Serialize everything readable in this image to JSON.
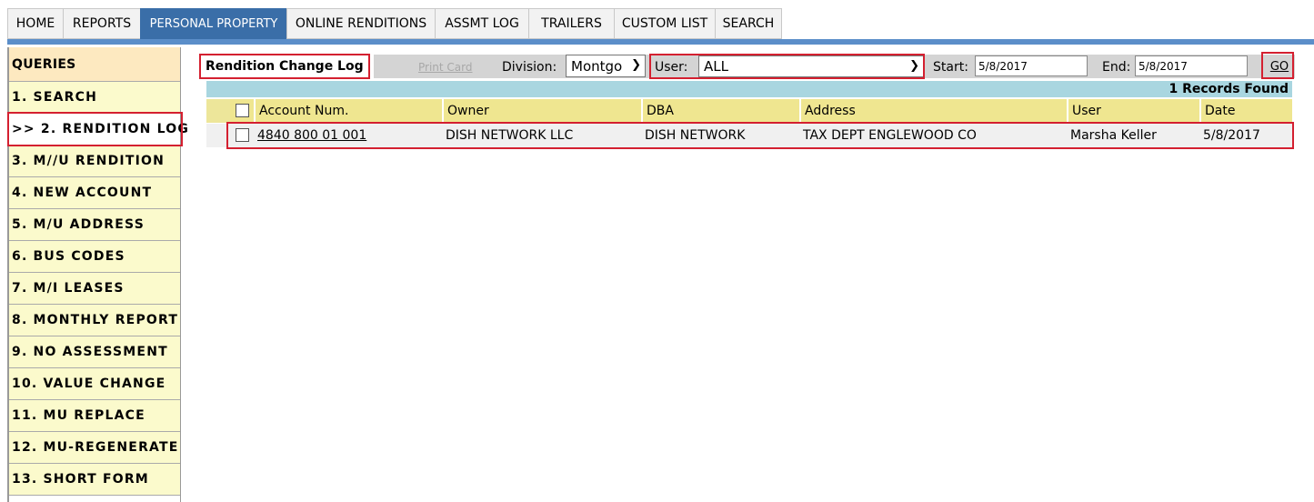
{
  "nav": {
    "tabs": [
      {
        "label": "HOME"
      },
      {
        "label": "REPORTS"
      },
      {
        "label": "PERSONAL PROPERTY"
      },
      {
        "label": "ONLINE RENDITIONS"
      },
      {
        "label": "ASSMT LOG"
      },
      {
        "label": "TRAILERS"
      },
      {
        "label": "CUSTOM LIST"
      },
      {
        "label": "SEARCH"
      }
    ],
    "active_tab": "PERSONAL PROPERTY",
    "accent_color": "#3a6ea8"
  },
  "sidebar": {
    "header": "QUERIES",
    "items": [
      {
        "label": "1. SEARCH"
      },
      {
        "label": ">> 2. RENDITION LOG"
      },
      {
        "label": "3. M//U RENDITION"
      },
      {
        "label": "4. NEW ACCOUNT"
      },
      {
        "label": "5. M/U ADDRESS"
      },
      {
        "label": "6. BUS CODES"
      },
      {
        "label": "7. M/I LEASES"
      },
      {
        "label": "8. MONTHLY REPORT"
      },
      {
        "label": "9. NO ASSESSMENT"
      },
      {
        "label": "10. VALUE CHANGE"
      },
      {
        "label": "11. MU REPLACE"
      },
      {
        "label": "12. MU-REGENERATE"
      },
      {
        "label": "13. SHORT FORM"
      }
    ]
  },
  "toolbar": {
    "title": "Rendition Change Log",
    "print_card": "Print Card",
    "division_label": "Division:",
    "division_value": "Montgo",
    "user_label": "User:",
    "user_value": "ALL",
    "start_label": "Start:",
    "start_value": "5/8/2017",
    "end_label": "End:",
    "end_value": "5/8/2017",
    "go_label": "GO"
  },
  "results": {
    "records_found": "1 Records Found",
    "columns": [
      "Account Num.",
      "Owner",
      "DBA",
      "Address",
      "User",
      "Date"
    ],
    "rows": [
      {
        "account": "4840 800 01 001",
        "owner": "DISH NETWORK LLC",
        "dba": "DISH NETWORK",
        "address": "TAX DEPT ENGLEWOOD CO",
        "user": "Marsha Keller",
        "date": "5/8/2017"
      }
    ]
  },
  "colors": {
    "highlight": "#d42030",
    "header_row": "#efe690",
    "records_bar": "#a9d6e0",
    "sidebar_bg": "#fbfacc"
  }
}
